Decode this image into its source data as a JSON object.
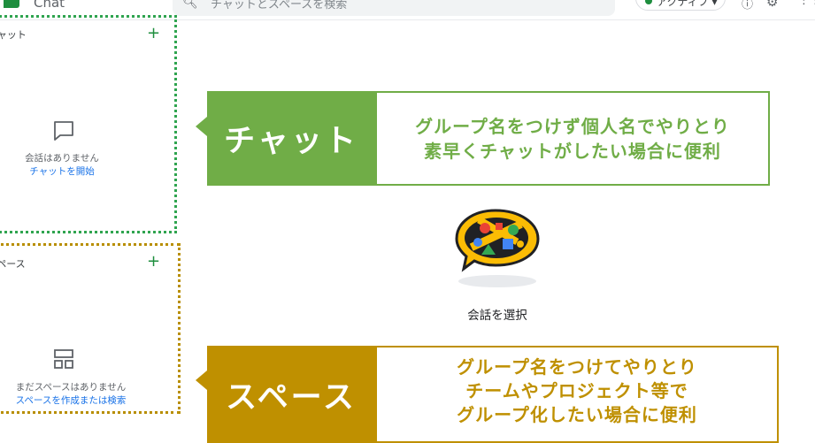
{
  "app": {
    "title": "Chat"
  },
  "search": {
    "placeholder": "チャットとスペースを検索"
  },
  "status": {
    "label": "アクティブ ▾"
  },
  "sidebar": {
    "chat": {
      "header": "チャット",
      "empty_text": "会話はありません",
      "empty_link": "チャットを開始"
    },
    "spaces": {
      "header": "スペース",
      "empty_text": "まだスペースはありません",
      "empty_link": "スペースを作成または検索"
    }
  },
  "main": {
    "empty_state": "会話を選択"
  },
  "callouts": {
    "chat": {
      "label": "チャット",
      "lines": [
        "グループ名をつけず個人名でやりとり",
        "素早くチャットがしたい場合に便利"
      ]
    },
    "space": {
      "label": "スペース",
      "lines": [
        "グループ名をつけてやりとり",
        "チームやプロジェクト等で",
        "グループ化したい場合に便利"
      ]
    }
  },
  "colors": {
    "chat_accent": "#70ad47",
    "space_accent": "#bf9000",
    "brand_green": "#1e8e3e",
    "link_blue": "#1a73e8"
  },
  "icons": [
    "search-icon",
    "help-icon",
    "gear-icon",
    "apps-grid-icon",
    "chat-bubble-icon",
    "spaces-grid-icon",
    "plus-icon"
  ]
}
